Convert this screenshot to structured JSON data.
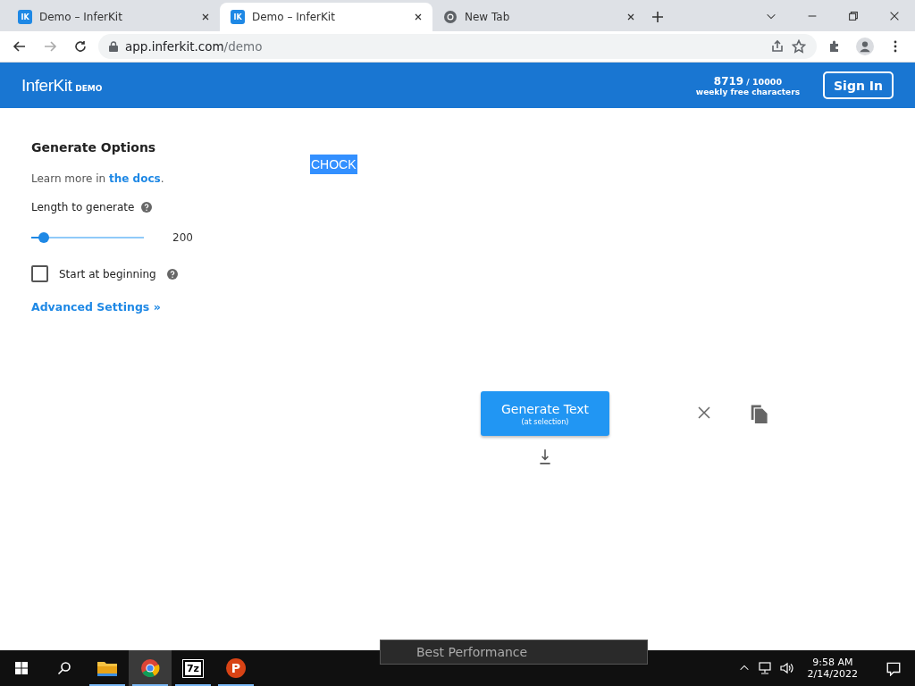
{
  "browser": {
    "tabs": [
      {
        "title": "Demo – InferKit",
        "kind": "inferkit",
        "icon_text": "IK",
        "selected": false
      },
      {
        "title": "Demo – InferKit",
        "kind": "inferkit",
        "icon_text": "IK",
        "selected": true
      },
      {
        "title": "New Tab",
        "kind": "chrome",
        "selected": false
      }
    ],
    "address": {
      "host": "app.inferkit.com",
      "path": "/demo"
    }
  },
  "header": {
    "logo": "InferKit",
    "logo_badge": "DEMO",
    "used": "8719",
    "limit": "/ 10000",
    "quota_label": "weekly free characters",
    "sign_in": "Sign In"
  },
  "options": {
    "title": "Generate Options",
    "learn_more": "Learn more in ",
    "docs_link": "the docs",
    "learn_more_end": ".",
    "length_label": "Length to generate",
    "length": {
      "level": 0.11,
      "value": "200"
    },
    "start_at_beginning": {
      "label": "Start at beginning",
      "checked": false
    },
    "advanced": "Advanced Settings »"
  },
  "editor": {
    "selected_text": "CHOCK"
  },
  "generate": {
    "label": "Generate Text",
    "sublabel": "(at selection)"
  },
  "popup": {
    "title": "Best Performance"
  },
  "taskbar": {
    "apps": [
      {
        "kind": "explorer",
        "selected": false
      },
      {
        "kind": "chrome",
        "selected": true
      },
      {
        "kind": "archiver",
        "label": "7z",
        "selected": false
      },
      {
        "kind": "psiphon",
        "label": "P",
        "selected": false
      }
    ],
    "time": "9:58 AM",
    "date": "2/14/2022"
  }
}
